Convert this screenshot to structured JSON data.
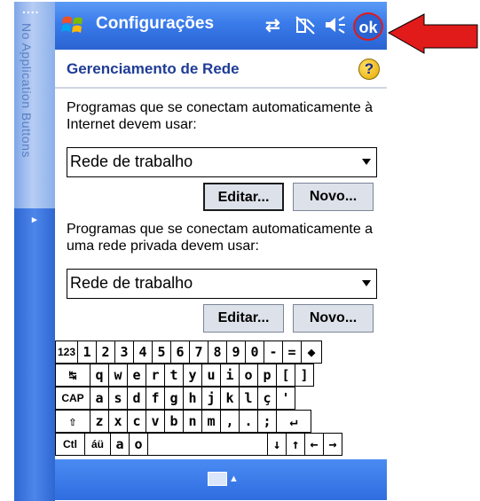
{
  "sidebar": {
    "label": "No Application Buttons",
    "dots": "....",
    "arrow_glyph": "▸"
  },
  "titlebar": {
    "title": "Configurações",
    "ok_label": "ok",
    "icons": [
      "network-sync-icon",
      "connectivity-icon",
      "speaker-icon"
    ]
  },
  "page": {
    "title": "Gerenciamento de Rede",
    "help_glyph": "?"
  },
  "internet_section": {
    "description": "Programas que se conectam automaticamente à Internet devem usar:",
    "selected": "Rede de trabalho",
    "edit_label": "Editar...",
    "new_label": "Novo..."
  },
  "private_section": {
    "description": "Programas que se conectam automaticamente a uma rede privada devem usar:",
    "selected": "Rede de trabalho",
    "edit_label": "Editar...",
    "new_label": "Novo..."
  },
  "keyboard": {
    "row1": [
      "123",
      "1",
      "2",
      "3",
      "4",
      "5",
      "6",
      "7",
      "8",
      "9",
      "0",
      "-",
      "=",
      "◆"
    ],
    "row2": [
      "↹",
      "q",
      "w",
      "e",
      "r",
      "t",
      "y",
      "u",
      "i",
      "o",
      "p",
      "[",
      "]"
    ],
    "row3": [
      "CAP",
      "a",
      "s",
      "d",
      "f",
      "g",
      "h",
      "j",
      "k",
      "l",
      "ç",
      "'"
    ],
    "row4": [
      "⇧",
      "z",
      "x",
      "c",
      "v",
      "b",
      "n",
      "m",
      ",",
      ".",
      ";",
      "↵"
    ],
    "row5": [
      "Ctl",
      "áü",
      "a",
      "o",
      "",
      "↓",
      "↑",
      "←",
      "→"
    ]
  },
  "colors": {
    "title_bar": "#3a7bea",
    "callout": "#e11a1a",
    "page_title": "#1f3c96"
  }
}
